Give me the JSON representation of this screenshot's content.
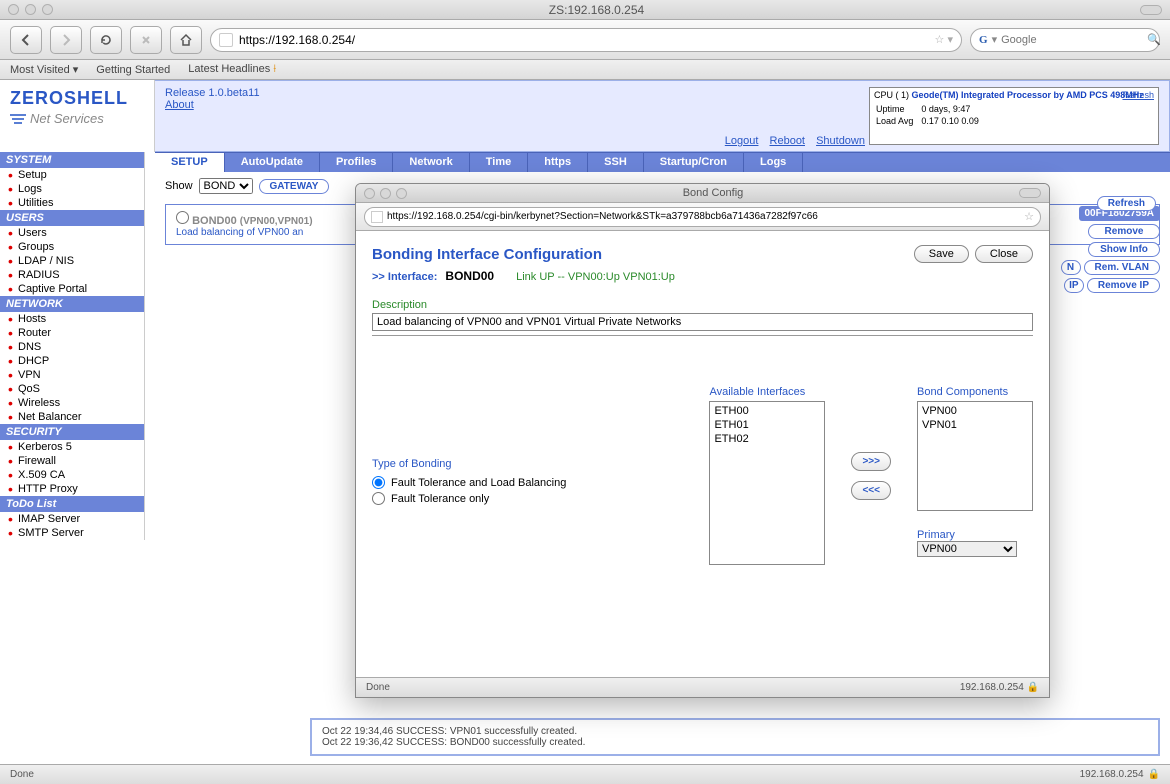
{
  "window_title": "ZS:192.168.0.254",
  "url": "https://192.168.0.254/",
  "search_placeholder": "Google",
  "bookmarks": [
    "Most Visited",
    "Getting Started",
    "Latest Headlines"
  ],
  "logo": {
    "line1": "ZEROSHELL",
    "line2": "Net Services"
  },
  "release": "Release 1.0.beta11",
  "about": "About",
  "toplinks": {
    "logout": "Logout",
    "reboot": "Reboot",
    "shutdown": "Shutdown"
  },
  "sysbox": {
    "cpu_lbl": "CPU ( 1)",
    "cpu_val": "Geode(TM) Integrated Processor by AMD PCS 498MHz",
    "refresh": "Refresh",
    "rows": [
      {
        "k": "Uptime",
        "v": "0 days, 9:47"
      },
      {
        "k": "Load Avg",
        "v": "0.17 0.10 0.09"
      }
    ]
  },
  "tabs": [
    "SETUP",
    "AutoUpdate",
    "Profiles",
    "Network",
    "Time",
    "https",
    "SSH",
    "Startup/Cron",
    "Logs"
  ],
  "active_tab": "SETUP",
  "sidebar": [
    {
      "hdr": "SYSTEM",
      "items": [
        "Setup",
        "Logs",
        "Utilities"
      ]
    },
    {
      "hdr": "USERS",
      "items": [
        "Users",
        "Groups",
        "LDAP / NIS",
        "RADIUS",
        "Captive Portal"
      ]
    },
    {
      "hdr": "NETWORK",
      "items": [
        "Hosts",
        "Router",
        "DNS",
        "DHCP",
        "VPN",
        "QoS",
        "Wireless",
        "Net Balancer"
      ]
    },
    {
      "hdr": "SECURITY",
      "items": [
        "Kerberos 5",
        "Firewall",
        "X.509 CA",
        "HTTP Proxy"
      ]
    },
    {
      "hdr": "ToDo List",
      "items": [
        "IMAP Server",
        "SMTP Server"
      ]
    }
  ],
  "show_label": "Show",
  "show_value": "BOND",
  "gateway_btn": "GATEWAY",
  "refresh_btn": "Refresh",
  "bond_entry": {
    "name": "BOND00",
    "sub": "(VPN00,VPN01)",
    "desc": "Load balancing of VPN00 an"
  },
  "right_ctrl": {
    "badge": "00FF1802759A",
    "buttons": [
      "Remove",
      "Show Info",
      "Rem. VLAN",
      "Remove IP"
    ],
    "left_labels": [
      "N",
      "IP"
    ]
  },
  "log_lines": [
    "Oct 22 19:34,46 SUCCESS: VPN01 successfully created.",
    "Oct 22 19:36,42 SUCCESS: BOND00 successfully created."
  ],
  "status_done": "Done",
  "status_ip": "192.168.0.254",
  "popup": {
    "title": "Bond Config",
    "url": "https://192.168.0.254/cgi-bin/kerbynet?Section=Network&STk=a379788bcb6a71436a7282f97c66",
    "heading": "Bonding Interface Configuration",
    "save": "Save",
    "close": "Close",
    "if_lbl": ">> Interface:",
    "if_val": "BOND00",
    "if_stat": "Link UP -- VPN00:Up VPN01:Up",
    "desc_lbl": "Description",
    "desc_val": "Load balancing of VPN00 and VPN01 Virtual Private Networks",
    "type_lbl": "Type of Bonding",
    "type_opts": [
      "Fault Tolerance and Load Balancing",
      "Fault Tolerance only"
    ],
    "type_sel": 0,
    "avail_lbl": "Available Interfaces",
    "avail": [
      "ETH00",
      "ETH01",
      "ETH02"
    ],
    "comp_lbl": "Bond Components",
    "comp": [
      "VPN00",
      "VPN01"
    ],
    "add_btn": ">>>",
    "rem_btn": "<<<",
    "primary_lbl": "Primary",
    "primary_val": "VPN00",
    "status_done": "Done",
    "status_r": "192.168.0.254"
  }
}
